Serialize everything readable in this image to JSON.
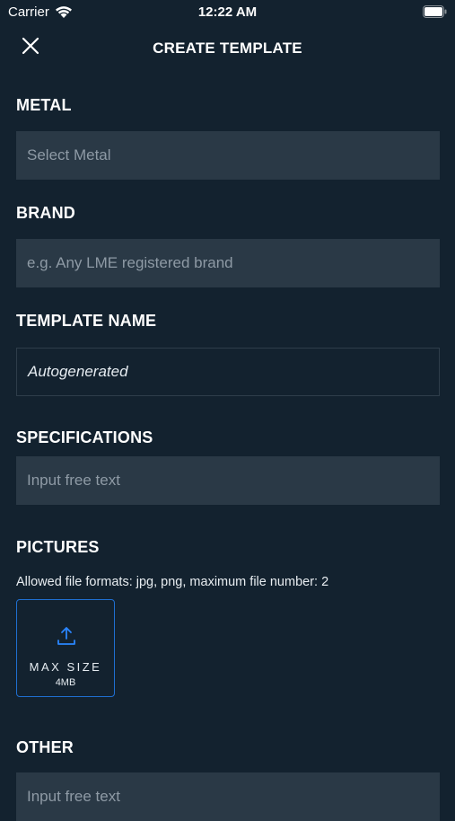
{
  "status_bar": {
    "carrier": "Carrier",
    "time": "12:22 AM",
    "icons": [
      "wifi-icon",
      "battery-icon"
    ]
  },
  "nav": {
    "title": "CREATE TEMPLATE",
    "close_icon": "close-icon"
  },
  "form": {
    "metal": {
      "label": "METAL",
      "placeholder": "Select Metal"
    },
    "brand": {
      "label": "BRAND",
      "placeholder": "e.g. Any LME registered brand"
    },
    "template_name": {
      "label": "TEMPLATE NAME",
      "value": "Autogenerated"
    },
    "specifications": {
      "label": "SPECIFICATIONS",
      "placeholder": "Input free text"
    },
    "pictures": {
      "label": "PICTURES",
      "hint": "Allowed file formats: jpg, png, maximum file number: 2",
      "upload_title": "MAX SIZE",
      "upload_subtitle": "4MB",
      "upload_icon": "upload-icon"
    },
    "other": {
      "label": "OTHER",
      "placeholder": "Input free text"
    }
  },
  "colors": {
    "background": "#13222f",
    "field": "#2a3946",
    "accent": "#1f6fd1"
  }
}
